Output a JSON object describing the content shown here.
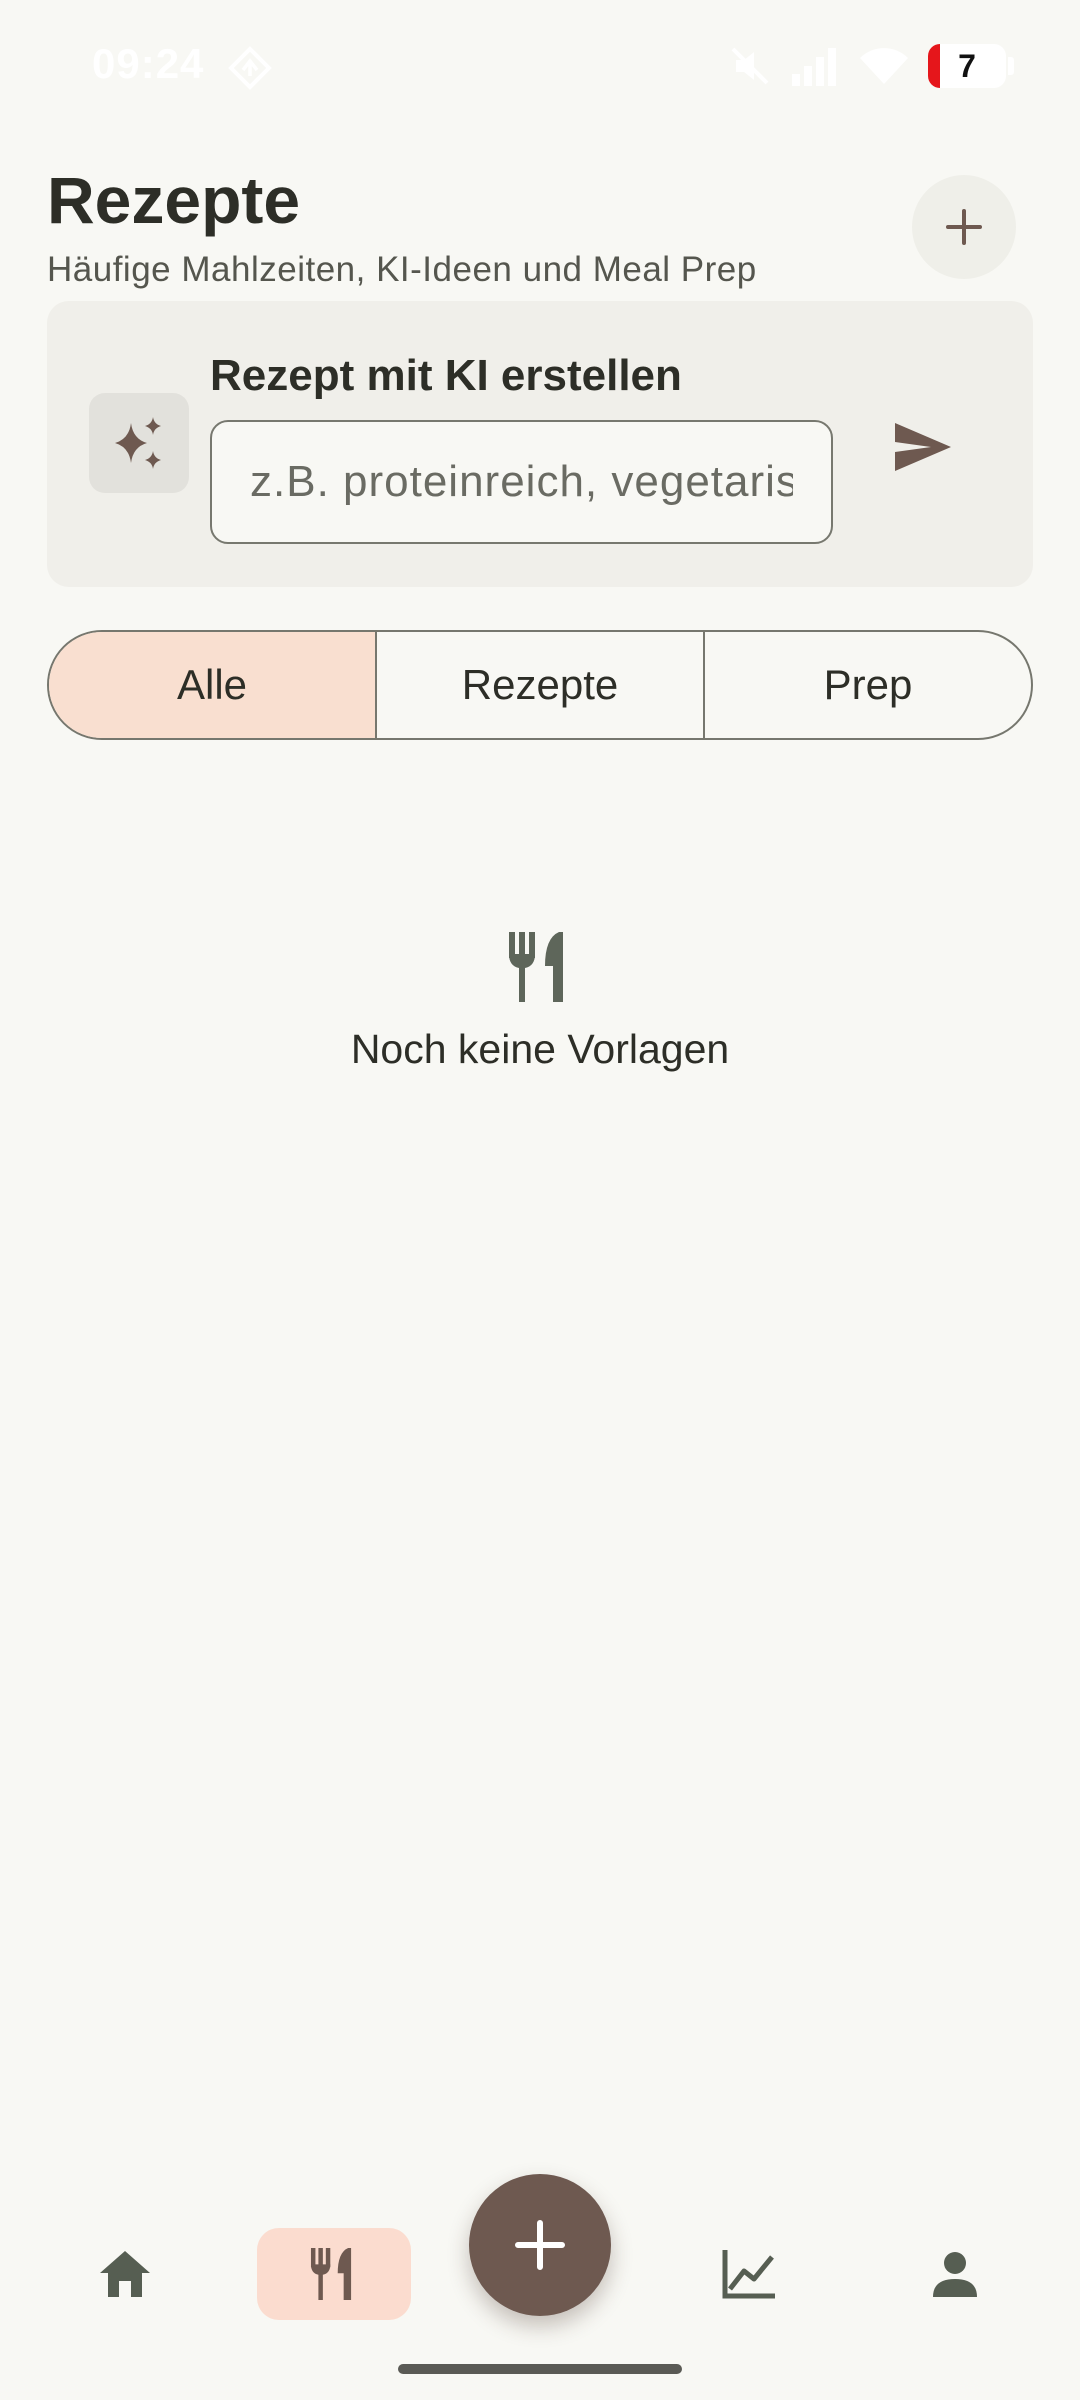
{
  "status_bar": {
    "time": "09:24",
    "battery_level": "7",
    "icons": [
      "navigation-icon",
      "mute-icon",
      "signal-icon",
      "wifi-icon",
      "battery-icon"
    ]
  },
  "header": {
    "title": "Rezepte",
    "subtitle": "Häufige Mahlzeiten, KI-Ideen und Meal Prep",
    "add_icon": "plus-icon"
  },
  "ai_card": {
    "title": "Rezept mit KI erstellen",
    "input_placeholder": "z.B. proteinreich, vegetarisch",
    "input_value": "",
    "icon": "sparkles-icon",
    "send_icon": "send-icon"
  },
  "filter": {
    "segments": [
      "Alle",
      "Rezepte",
      "Prep"
    ],
    "selected": "Alle"
  },
  "empty_state": {
    "icon": "cutlery-icon",
    "text": "Noch keine Vorlagen"
  },
  "bottom_nav": {
    "items": [
      {
        "icon": "home-icon",
        "active": false
      },
      {
        "icon": "cutlery-icon",
        "active": true
      },
      {
        "icon": "plus-icon",
        "fab": true
      },
      {
        "icon": "chart-icon",
        "active": false
      },
      {
        "icon": "person-icon",
        "active": false
      }
    ]
  },
  "colors": {
    "background": "#f8f8f4",
    "accent": "#6e5950",
    "active_tint": "#f9dfd0",
    "text": "#2d2e27"
  }
}
